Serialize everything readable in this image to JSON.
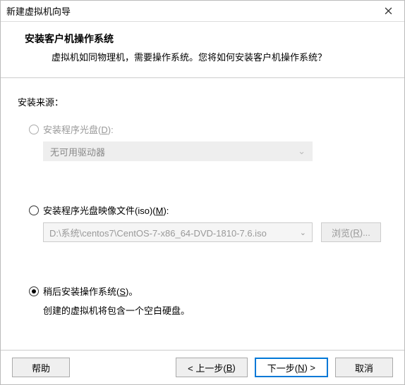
{
  "window": {
    "title": "新建虚拟机向导"
  },
  "header": {
    "heading": "安装客户机操作系统",
    "subheading": "虚拟机如同物理机，需要操作系统。您将如何安装客户机操作系统？"
  },
  "content": {
    "source_label": "安装来源：",
    "opt_disc": {
      "label_pre": "安装程序光盘(",
      "hotkey": "D",
      "label_post": "):",
      "drive_text": "无可用驱动器"
    },
    "opt_iso": {
      "label_pre": "安装程序光盘映像文件(iso)(",
      "hotkey": "M",
      "label_post": "):",
      "path": "D:\\系统\\centos7\\CentOS-7-x86_64-DVD-1810-7.6.iso",
      "browse_pre": "浏览(",
      "browse_hotkey": "R",
      "browse_post": ")..."
    },
    "opt_later": {
      "label_pre": "稍后安装操作系统(",
      "hotkey": "S",
      "label_post": ")。",
      "desc": "创建的虚拟机将包含一个空白硬盘。"
    }
  },
  "footer": {
    "help": "帮助",
    "back_pre": "< 上一步(",
    "back_hotkey": "B",
    "back_post": ")",
    "next_pre": "下一步(",
    "next_hotkey": "N",
    "next_post": ") >",
    "cancel": "取消"
  }
}
